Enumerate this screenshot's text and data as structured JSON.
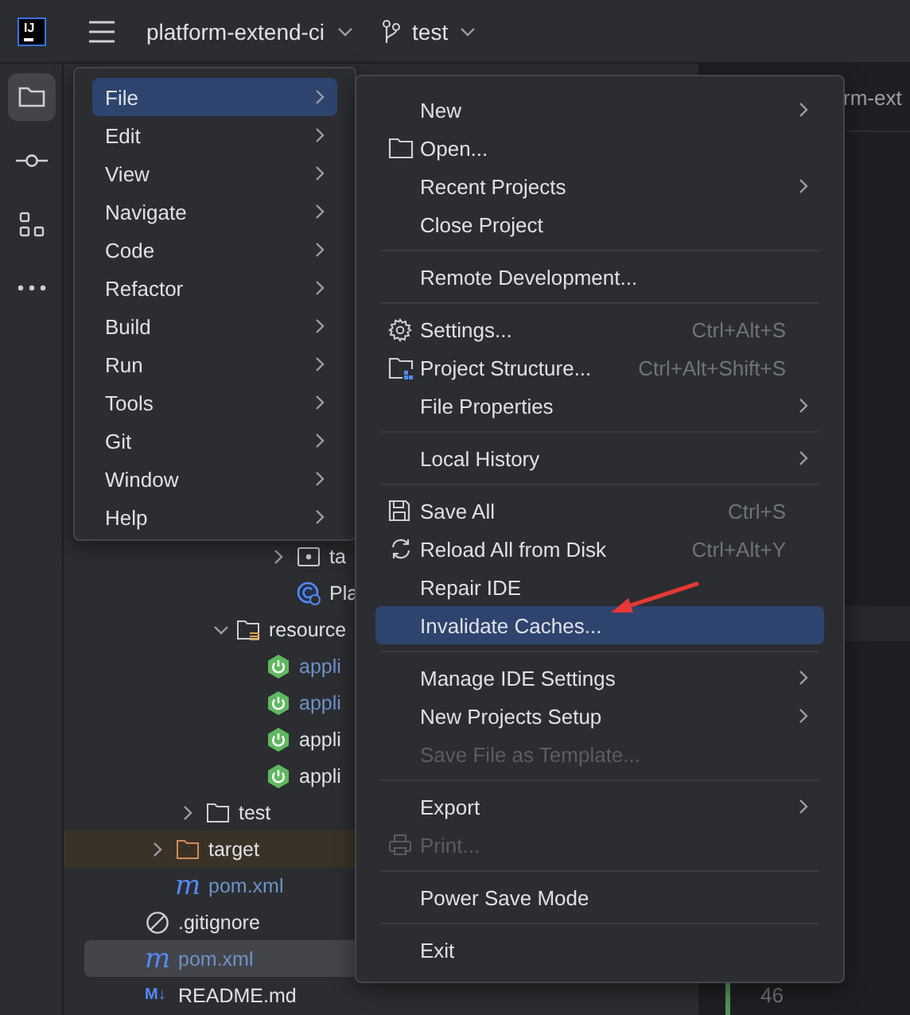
{
  "top_bar": {
    "logo": "IJ",
    "project": "platform-extend-ci",
    "branch": "test"
  },
  "tool_strip": [
    {
      "kind": "project",
      "selected": true
    },
    {
      "kind": "commit",
      "selected": false
    },
    {
      "kind": "structure",
      "selected": false
    },
    {
      "kind": "more",
      "selected": false
    }
  ],
  "project_tree": [
    {
      "children": [
        {
          "children": [
            {
              "children": [
                {
                  "children": [
                    {
                      "children": [
                        {
                          "label": "ta",
                          "kind": "package",
                          "expanded": false,
                          "selected": false,
                          "modified": false
                        },
                        {
                          "label": "Pla",
                          "kind": "spring-class",
                          "selected": false,
                          "modified": false
                        }
                      ]
                    }
                  ]
                },
                {
                  "label": "resource",
                  "kind": "resources",
                  "expanded": true,
                  "selected": false,
                  "modified": false,
                  "children": [
                    {
                      "label": "appli",
                      "kind": "spring-config",
                      "selected": false,
                      "modified": true
                    },
                    {
                      "label": "appli",
                      "kind": "spring-config",
                      "selected": false,
                      "modified": true
                    },
                    {
                      "label": "appli",
                      "kind": "spring-config",
                      "selected": false,
                      "modified": false
                    },
                    {
                      "label": "appli",
                      "kind": "spring-config",
                      "selected": false,
                      "modified": false
                    }
                  ]
                }
              ]
            },
            {
              "label": "test",
              "kind": "folder",
              "expanded": false,
              "selected": false,
              "modified": false
            }
          ]
        },
        {
          "label": "target",
          "kind": "excluded-folder",
          "expanded": false,
          "selected": false,
          "modified": false
        },
        {
          "label": "pom.xml",
          "kind": "maven",
          "icon_text": "m",
          "selected": false,
          "modified": true
        }
      ]
    },
    {
      "label": ".gitignore",
      "kind": "ignore",
      "selected": false,
      "modified": false
    },
    {
      "label": "pom.xml",
      "kind": "maven",
      "icon_text": "m",
      "selected": true,
      "modified": true
    },
    {
      "label": "README.md",
      "kind": "markdown",
      "icon_text": "M↓",
      "selected": false,
      "modified": false
    }
  ],
  "editor": {
    "tab": "rm-ext",
    "line_number": "46"
  },
  "main_menu": [
    {
      "label": "File",
      "submenu": true,
      "selected": true
    },
    {
      "label": "Edit",
      "submenu": true,
      "selected": false
    },
    {
      "label": "View",
      "submenu": true,
      "selected": false
    },
    {
      "label": "Navigate",
      "submenu": true,
      "selected": false
    },
    {
      "label": "Code",
      "submenu": true,
      "selected": false
    },
    {
      "label": "Refactor",
      "submenu": true,
      "selected": false
    },
    {
      "label": "Build",
      "submenu": true,
      "selected": false
    },
    {
      "label": "Run",
      "submenu": true,
      "selected": false
    },
    {
      "label": "Tools",
      "submenu": true,
      "selected": false
    },
    {
      "label": "Git",
      "submenu": true,
      "selected": false
    },
    {
      "label": "Window",
      "submenu": true,
      "selected": false
    },
    {
      "label": "Help",
      "submenu": true,
      "selected": false
    }
  ],
  "file_menu": [
    {
      "kind": "item",
      "label": "New",
      "submenu": true,
      "selected": false,
      "disabled": false
    },
    {
      "kind": "open",
      "label": "Open...",
      "submenu": false,
      "selected": false,
      "disabled": false
    },
    {
      "kind": "item",
      "label": "Recent Projects",
      "submenu": true,
      "selected": false,
      "disabled": false
    },
    {
      "kind": "item",
      "label": "Close Project",
      "submenu": false,
      "selected": false,
      "disabled": false
    },
    {
      "kind": "separator"
    },
    {
      "kind": "item",
      "label": "Remote Development...",
      "submenu": false,
      "selected": false,
      "disabled": false
    },
    {
      "kind": "separator"
    },
    {
      "kind": "settings",
      "label": "Settings...",
      "shortcut": "Ctrl+Alt+S",
      "submenu": false,
      "selected": false,
      "disabled": false
    },
    {
      "kind": "project-structure",
      "label": "Project Structure...",
      "shortcut": "Ctrl+Alt+Shift+S",
      "submenu": false,
      "selected": false,
      "disabled": false
    },
    {
      "kind": "item",
      "label": "File Properties",
      "submenu": true,
      "selected": false,
      "disabled": false
    },
    {
      "kind": "separator"
    },
    {
      "kind": "item",
      "label": "Local History",
      "submenu": true,
      "selected": false,
      "disabled": false
    },
    {
      "kind": "separator"
    },
    {
      "kind": "save",
      "label": "Save All",
      "shortcut": "Ctrl+S",
      "submenu": false,
      "selected": false,
      "disabled": false
    },
    {
      "kind": "reload",
      "label": "Reload All from Disk",
      "shortcut": "Ctrl+Alt+Y",
      "submenu": false,
      "selected": false,
      "disabled": false
    },
    {
      "kind": "item",
      "label": "Repair IDE",
      "submenu": false,
      "selected": false,
      "disabled": false
    },
    {
      "kind": "item",
      "label": "Invalidate Caches...",
      "submenu": false,
      "selected": true,
      "disabled": false
    },
    {
      "kind": "separator"
    },
    {
      "kind": "item",
      "label": "Manage IDE Settings",
      "submenu": true,
      "selected": false,
      "disabled": false
    },
    {
      "kind": "item",
      "label": "New Projects Setup",
      "submenu": true,
      "selected": false,
      "disabled": false
    },
    {
      "kind": "item",
      "label": "Save File as Template...",
      "submenu": false,
      "selected": false,
      "disabled": true
    },
    {
      "kind": "separator"
    },
    {
      "kind": "item",
      "label": "Export",
      "submenu": true,
      "selected": false,
      "disabled": false
    },
    {
      "kind": "print",
      "label": "Print...",
      "submenu": false,
      "selected": false,
      "disabled": true
    },
    {
      "kind": "separator"
    },
    {
      "kind": "item",
      "label": "Power Save Mode",
      "submenu": false,
      "selected": false,
      "disabled": false
    },
    {
      "kind": "separator"
    },
    {
      "kind": "item",
      "label": "Exit",
      "submenu": false,
      "selected": false,
      "disabled": false
    }
  ]
}
